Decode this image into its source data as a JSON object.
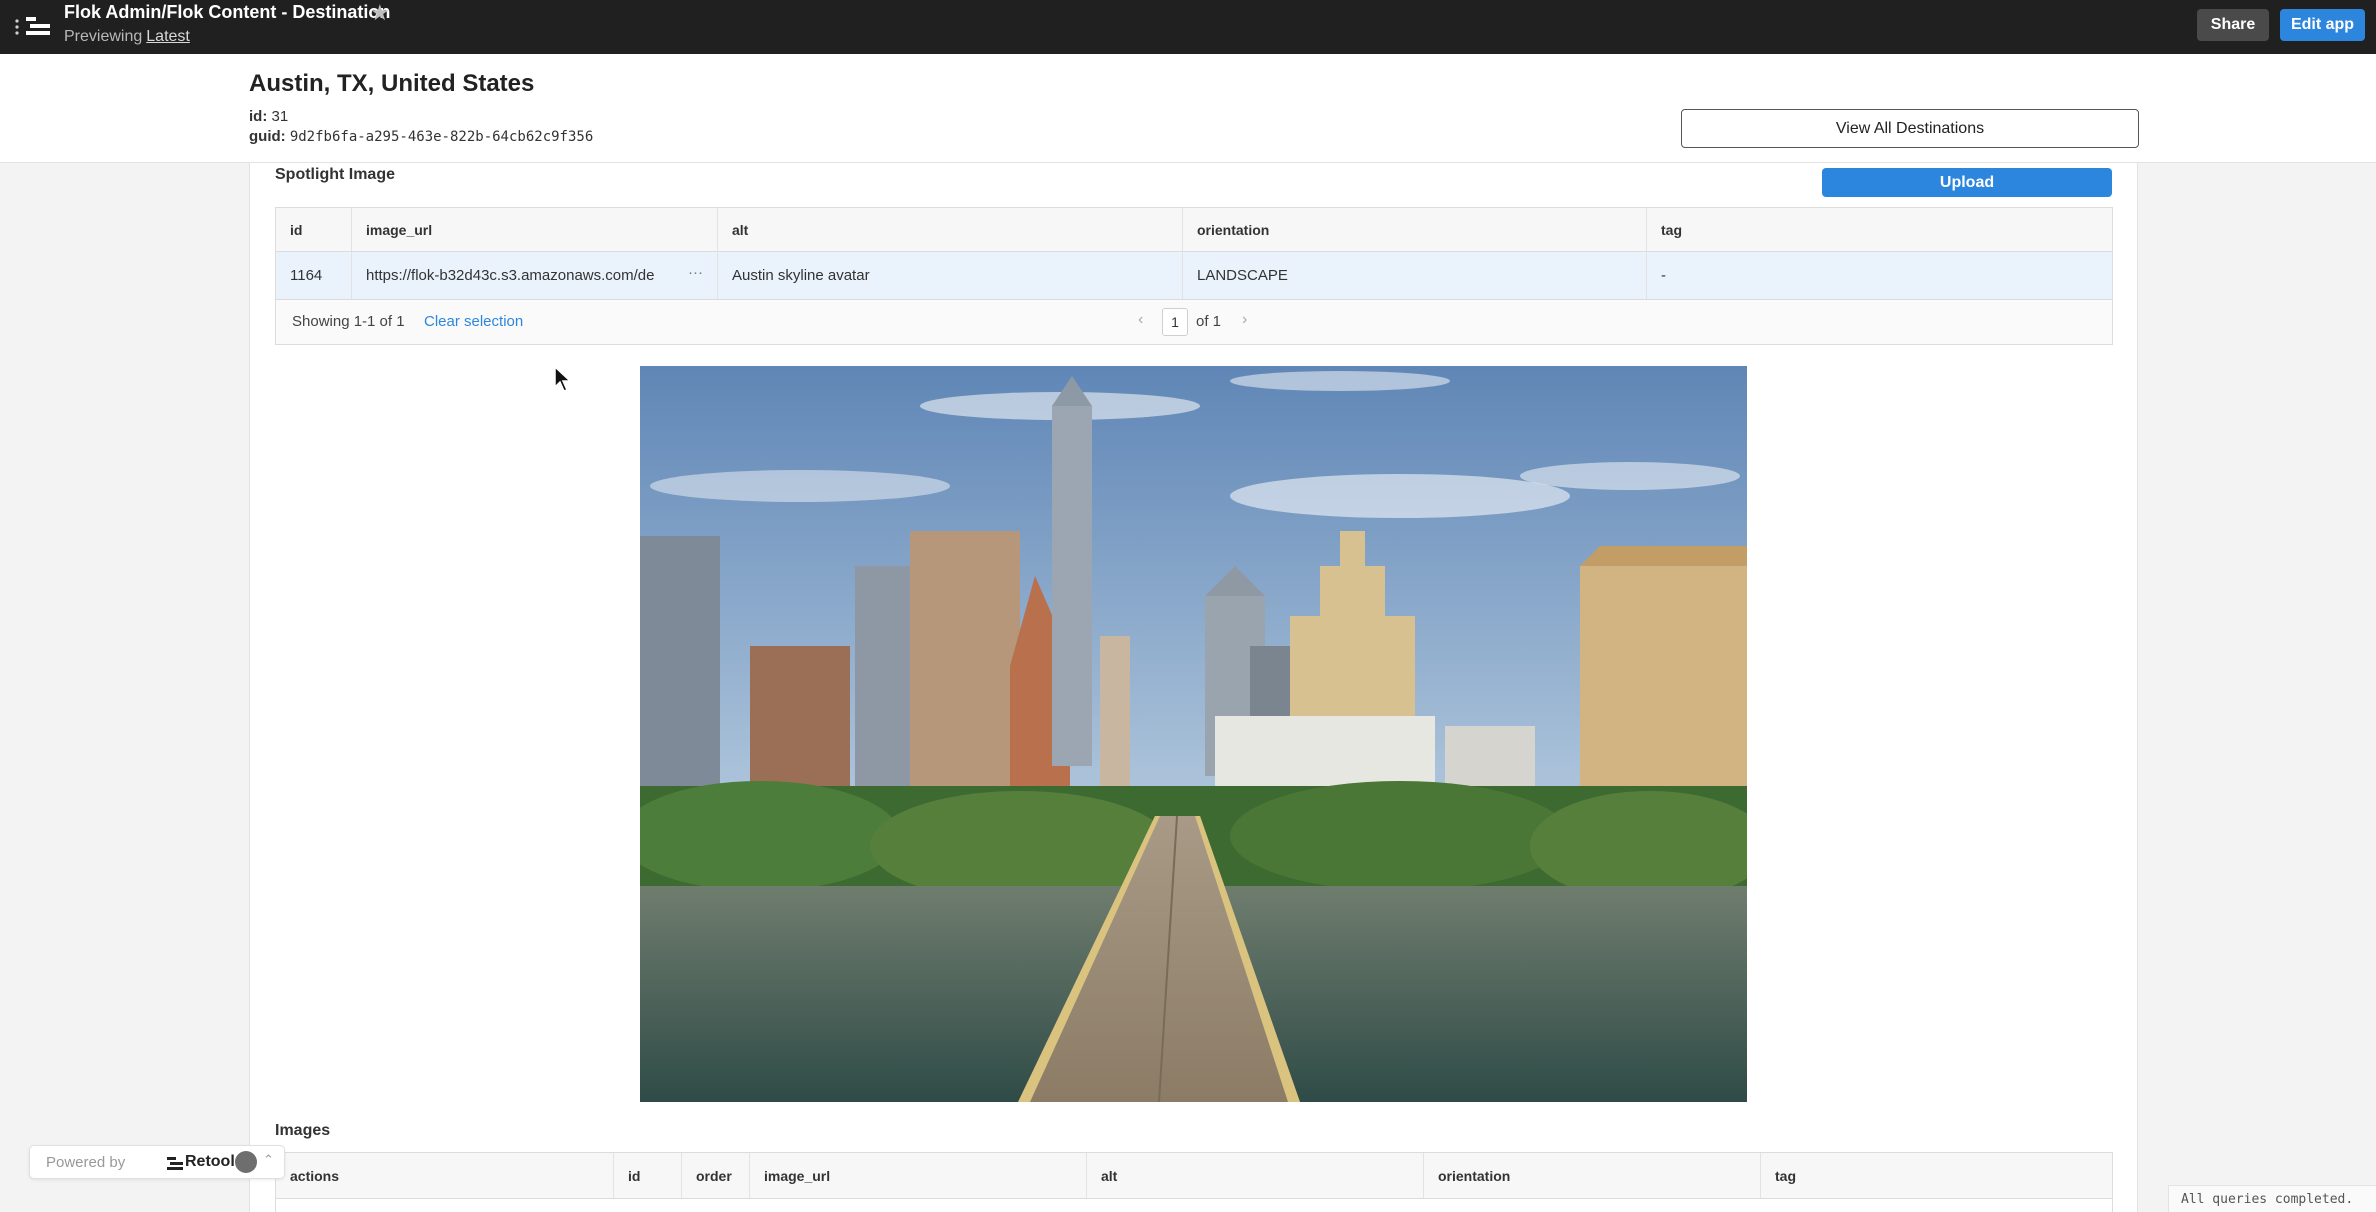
{
  "topbar": {
    "title": "Flok Admin/Flok Content - Destination",
    "previewing_label": "Previewing",
    "version": "Latest",
    "share_label": "Share",
    "edit_label": "Edit app"
  },
  "header": {
    "title": "Austin, TX, United States",
    "id_label": "id:",
    "id_value": "31",
    "guid_label": "guid:",
    "guid_value": "9d2fb6fa-a295-463e-822b-64cb62c9f356",
    "view_all_label": "View All Destinations"
  },
  "spotlight": {
    "title": "Spotlight Image",
    "upload_label": "Upload",
    "columns": [
      "id",
      "image_url",
      "alt",
      "orientation",
      "tag"
    ],
    "row": {
      "id": "1164",
      "image_url": "https://flok-b32d43c.s3.amazonaws.com/de",
      "alt": "Austin skyline avatar",
      "orientation": "LANDSCAPE",
      "tag": "-"
    },
    "ellipsis": "···",
    "showing": "Showing 1-1 of 1",
    "clear_selection": "Clear selection",
    "page": "1",
    "page_of": "of 1"
  },
  "images": {
    "title": "Images",
    "columns": [
      "actions",
      "id",
      "order",
      "image_url",
      "alt",
      "orientation",
      "tag"
    ]
  },
  "footer": {
    "powered_by": "Powered by",
    "brand": "Retool",
    "status": "All queries completed."
  },
  "colors": {
    "topbar_bg": "#202020",
    "accent": "#2d86de",
    "selected_row": "#eaf2fc"
  }
}
